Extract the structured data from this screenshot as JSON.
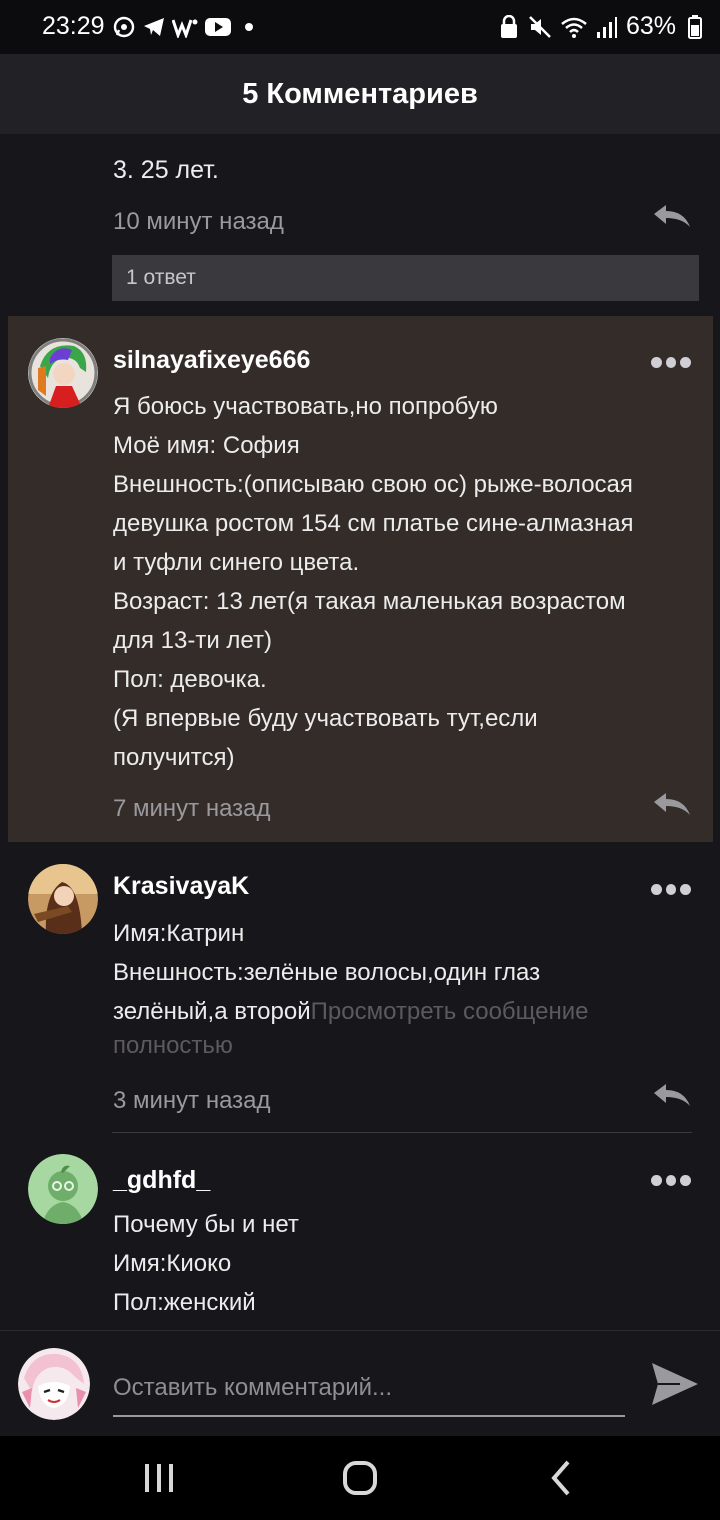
{
  "status_bar": {
    "time": "23:29",
    "battery": "63%",
    "left_icons": [
      "whatsapp-icon",
      "telegram-icon",
      "w-app-icon",
      "youtube-icon",
      "dot-icon"
    ],
    "right_icons": [
      "lock-icon",
      "mute-icon",
      "wifi-icon",
      "signal-icon",
      "battery-icon"
    ]
  },
  "header": {
    "title": "5 Комментариев"
  },
  "previous_comment": {
    "text": "3. 25 лет.",
    "time": "10 минут назад",
    "replies_label": "1 ответ"
  },
  "comments": [
    {
      "username": "silnayafixeye666",
      "lines": [
        "Я боюсь участвовать,но попробую",
        "Моё имя: София",
        "Внешность:(описываю свою ос) рыже-волосая",
        "девушка ростом 154 см платье сине-алмазная",
        "и туфли синего цвета.",
        "Возраст: 13 лет(я такая маленькая возрастом",
        "для 13-ти лет)",
        "Пол: девочка.",
        "(Я впервые буду участвовать тут,если",
        "получится)"
      ],
      "time": "7 минут назад",
      "highlighted": true
    },
    {
      "username": "KrasivayaK",
      "lines": [
        "Имя:Катрин",
        "Внешность:зелёные волосы,один глаз"
      ],
      "line3_text": "зелёный,а второй",
      "read_more": "Просмотреть сообщение",
      "read_more_2": "полностью",
      "time": "3 минут назад"
    },
    {
      "username": "_gdhfd_",
      "lines": [
        "Почему бы и нет",
        "Имя:Киоко",
        "Пол:женский"
      ]
    }
  ],
  "composer": {
    "placeholder": "Оставить комментарий..."
  },
  "colors": {
    "background": "#17161a",
    "highlight": "#332c28",
    "header": "#222125"
  }
}
